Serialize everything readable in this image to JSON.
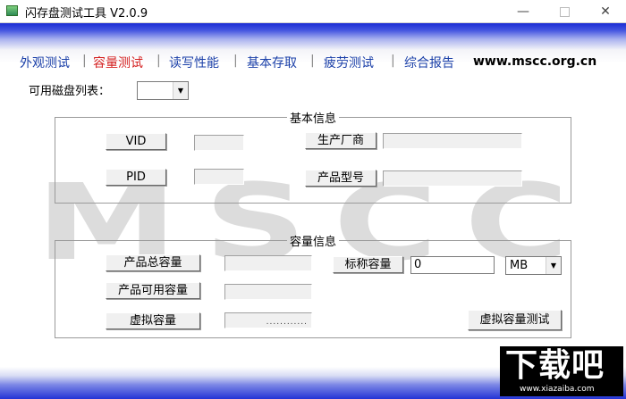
{
  "window": {
    "title": "闪存盘测试工具  V2.0.9"
  },
  "nav": {
    "items": [
      {
        "label": "外观测试",
        "active": false
      },
      {
        "label": "容量测试",
        "active": true
      },
      {
        "label": "读写性能",
        "active": false
      },
      {
        "label": "基本存取",
        "active": false
      },
      {
        "label": "疲劳测试",
        "active": false
      },
      {
        "label": "综合报告",
        "active": false
      }
    ],
    "website": "www.mscc.org.cn"
  },
  "watermark": "MSCC",
  "disk_list": {
    "label": "可用磁盘列表：",
    "value": ""
  },
  "basic_info": {
    "title": "基本信息",
    "vid_label": "VID",
    "pid_label": "PID",
    "vendor_label": "生产厂商",
    "model_label": "产品型号",
    "vid_value": "",
    "pid_value": "",
    "vendor_value": "",
    "model_value": ""
  },
  "capacity_info": {
    "title": "容量信息",
    "total_label": "产品总容量",
    "available_label": "产品可用容量",
    "virtual_label": "虚拟容量",
    "nominal_label": "标称容量",
    "nominal_value": "0",
    "unit_value": "MB",
    "virtual_test_label": "虚拟容量测试",
    "virtual_dots": "............"
  },
  "badge": {
    "main": "下载吧",
    "sub": "www.xiazaiba.com"
  }
}
